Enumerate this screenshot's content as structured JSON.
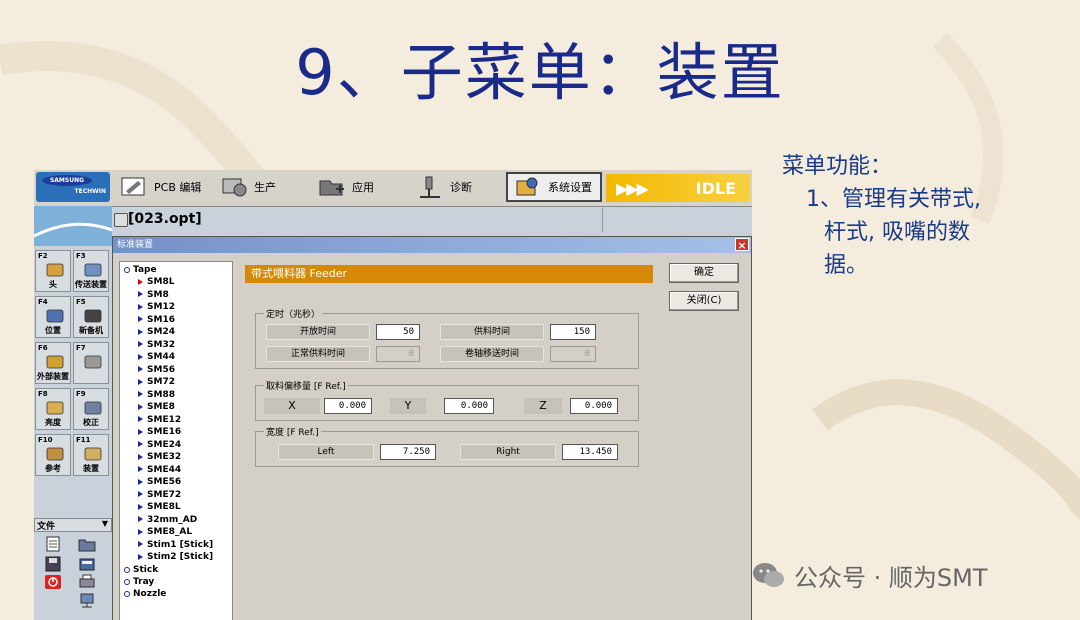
{
  "slide": {
    "title": "9、子菜单：装置",
    "notes": {
      "heading": "菜单功能：",
      "item": "1、管理有关带式,",
      "line2": "杆式, 吸嘴的数",
      "line3": "据。"
    },
    "watermark": "公众号 · 顺为SMT"
  },
  "toolbar": {
    "logo_line1": "SAMSUNG",
    "logo_line2": "TECHWIN",
    "buttons": [
      {
        "label": "PCB 编辑",
        "icon": "pcb-edit-icon"
      },
      {
        "label": "生产",
        "icon": "production-icon"
      },
      {
        "label": "应用",
        "icon": "application-icon"
      },
      {
        "label": "诊断",
        "icon": "diagnosis-icon"
      },
      {
        "label": "系统设置",
        "icon": "system-settings-icon"
      }
    ],
    "status": "IDLE",
    "status_arrows": "▶▶▶"
  },
  "left_panel": {
    "keys": [
      {
        "num": "F2",
        "label": "头"
      },
      {
        "num": "F3",
        "label": "传送装置"
      },
      {
        "num": "F4",
        "label": "位置"
      },
      {
        "num": "F5",
        "label": "新备机"
      },
      {
        "num": "F6",
        "label": "外部装置"
      },
      {
        "num": "F7",
        "label": ""
      },
      {
        "num": "F8",
        "label": "亮度"
      },
      {
        "num": "F9",
        "label": "校正"
      },
      {
        "num": "F10",
        "label": "参考"
      },
      {
        "num": "F11",
        "label": "装置"
      }
    ],
    "file_menu": "文件"
  },
  "file_bar": {
    "filename": "[023.opt]"
  },
  "dialog": {
    "title": "标准装置",
    "close": "×",
    "tree": {
      "root_items": [
        "Tape",
        "Stick",
        "Tray",
        "Nozzle"
      ],
      "tape_children": [
        "SM8L",
        "SM8",
        "SM12",
        "SM16",
        "SM24",
        "SM32",
        "SM44",
        "SM56",
        "SM72",
        "SM88",
        "SME8",
        "SME12",
        "SME16",
        "SME24",
        "SME32",
        "SME44",
        "SME56",
        "SME72",
        "SME8L",
        "32mm_AD",
        "SME8_AL",
        "Stim1 [Stick]",
        "Stim2 [Stick]"
      ],
      "selected": "SM8L"
    },
    "header": "带式喂料器 Feeder",
    "ok_button": "确定",
    "close_button": "关闭(C)",
    "timing": {
      "group_label": "定时（兆秒）",
      "open_time_label": "开放时间",
      "open_time": "50",
      "feed_time_label": "供料时间",
      "feed_time": "150",
      "normal_feed_label": "正常供料时间",
      "normal_feed": "0",
      "reel_move_label": "卷轴移送时间",
      "reel_move": "0"
    },
    "pickup_offset": {
      "group_label": "取料偏移量 [F Ref.]",
      "x_label": "X",
      "x": "0.000",
      "y_label": "Y",
      "y": "0.000",
      "z_label": "Z",
      "z": "0.000"
    },
    "width": {
      "group_label": "宽度 [F Ref.]",
      "left_label": "Left",
      "left": "7.250",
      "right_label": "Right",
      "right": "13.450"
    }
  }
}
